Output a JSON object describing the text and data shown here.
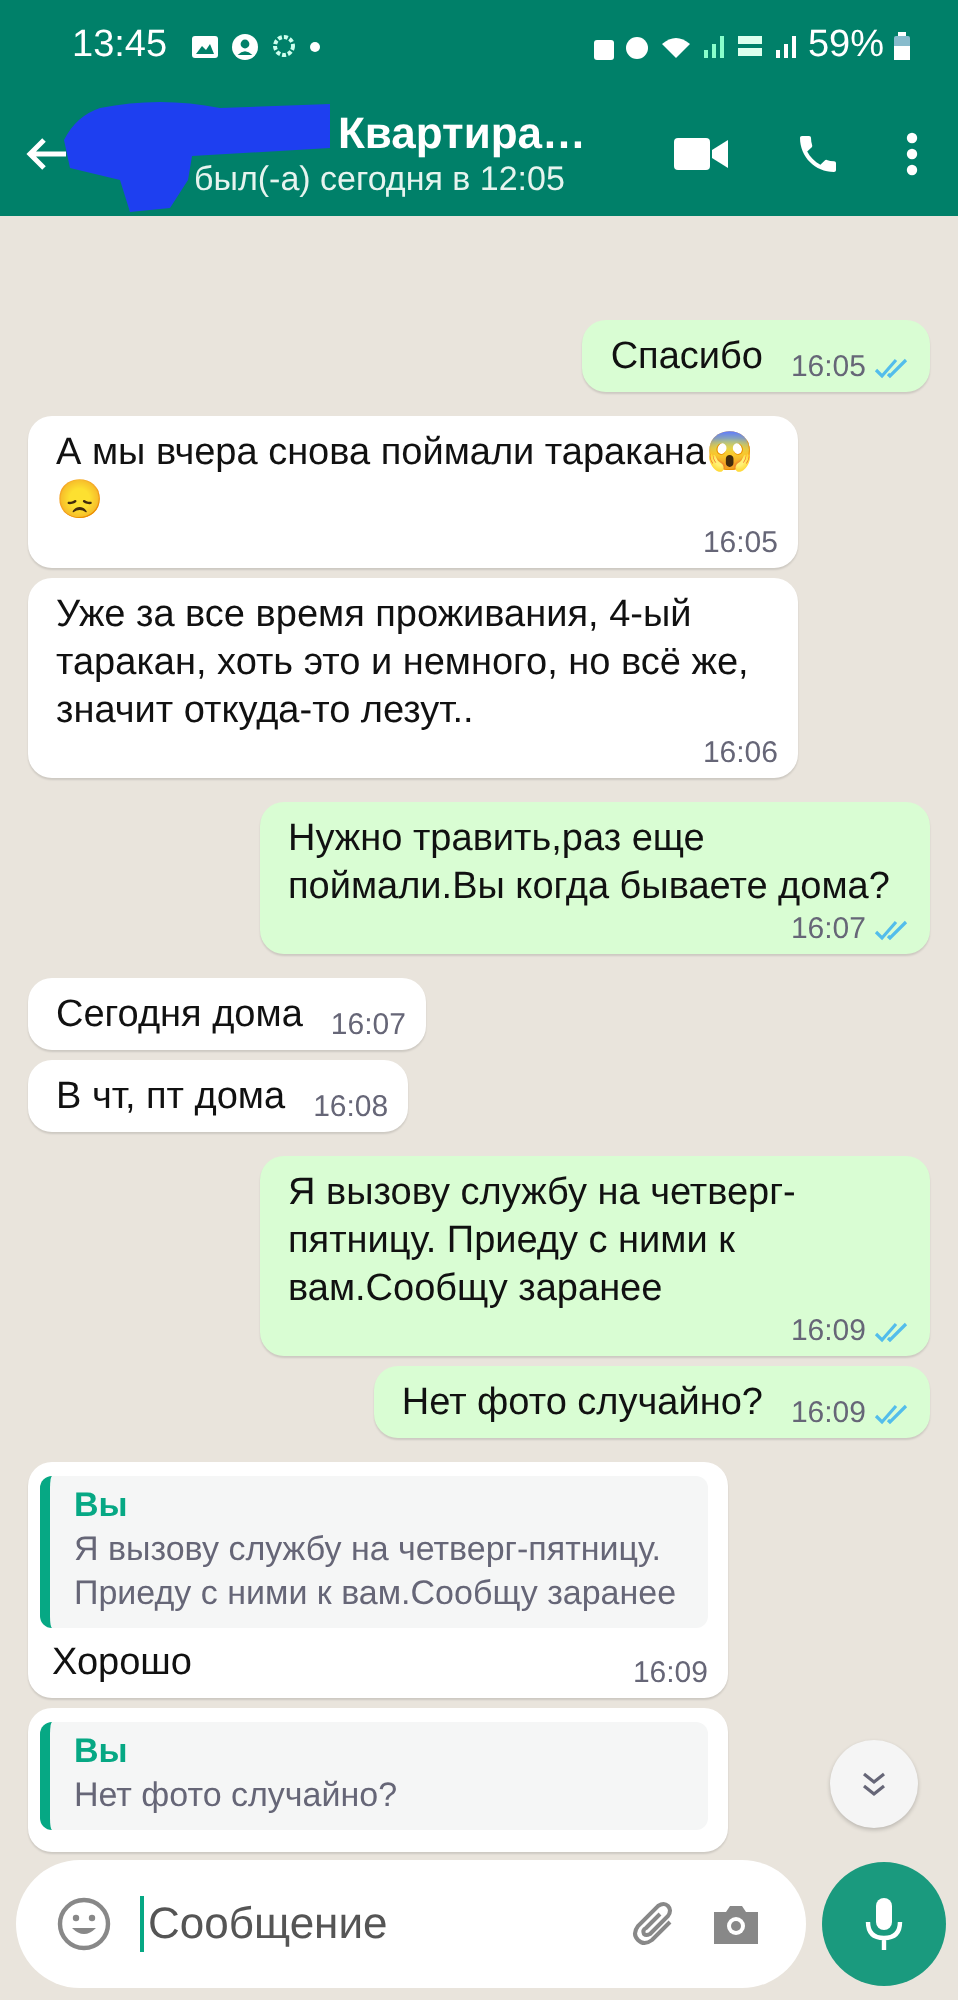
{
  "status_bar": {
    "time": "13:45",
    "battery": "59%"
  },
  "header": {
    "contact_name": "Квартира…",
    "last_seen": "был(-а) сегодня в 12:05"
  },
  "messages": [
    {
      "kind": "out",
      "text": "Спасибо",
      "time": "16:05",
      "read": true
    },
    {
      "kind": "in",
      "text": "А мы вчера снова поймали таракана😱😞",
      "time": "16:05"
    },
    {
      "kind": "in",
      "text": "Уже за все время проживания, 4-ый таракан, хоть это и немного, но всё же, значит откуда-то лезут..",
      "time": "16:06"
    },
    {
      "kind": "out",
      "text": "Нужно травить,раз еще поймали.Вы когда бываете дома?",
      "time": "16:07",
      "read": true
    },
    {
      "kind": "in",
      "text": "Сегодня дома",
      "time": "16:07"
    },
    {
      "kind": "in",
      "text": "В чт, пт дома",
      "time": "16:08"
    },
    {
      "kind": "out",
      "text": "Я вызову службу на четверг-пятницу. Приеду с ними к вам.Сообщу заранее",
      "time": "16:09",
      "read": true
    },
    {
      "kind": "out",
      "text": "Нет фото случайно?",
      "time": "16:09",
      "read": true
    },
    {
      "kind": "in",
      "quote": {
        "author": "Вы",
        "text": "Я вызову службу на четверг-пятницу. Приеду с ними к вам.Сообщу заранее"
      },
      "text": "Хорошо",
      "time": "16:09"
    },
    {
      "kind": "in",
      "quote": {
        "author": "Вы",
        "text": "Нет фото случайно?"
      }
    }
  ],
  "composer": {
    "placeholder": "Сообщение"
  }
}
